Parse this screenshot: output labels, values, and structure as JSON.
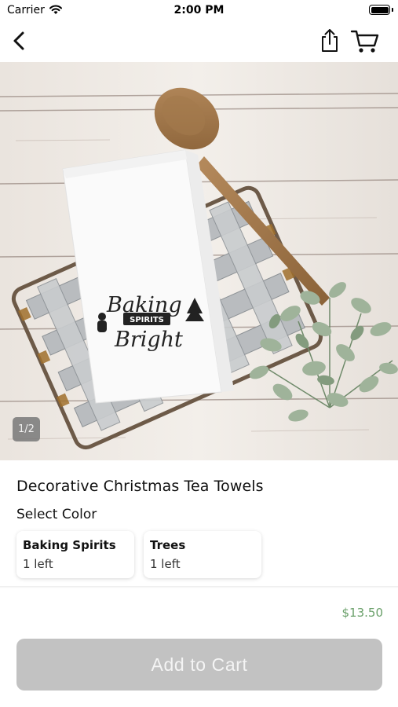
{
  "status_bar": {
    "carrier": "Carrier",
    "time": "2:00 PM"
  },
  "nav": {
    "back_icon": "chevron-left-icon",
    "share_icon": "share-icon",
    "cart_icon": "cart-icon"
  },
  "gallery": {
    "page_indicator": "1/2",
    "towel_print": {
      "line1": "Baking",
      "banner": "SPIRITS",
      "line2": "Bright"
    }
  },
  "product": {
    "title": "Decorative Christmas Tea Towels",
    "select_color_label": "Select Color",
    "options": [
      {
        "name": "Baking Spirits",
        "stock": "1 left"
      },
      {
        "name": "Trees",
        "stock": "1 left"
      }
    ],
    "price": "$13.50"
  },
  "actions": {
    "add_to_cart_label": "Add to Cart"
  },
  "colors": {
    "price_green": "#6aa06a",
    "button_disabled": "#c2c2c2",
    "indicator_bg": "#787878"
  }
}
